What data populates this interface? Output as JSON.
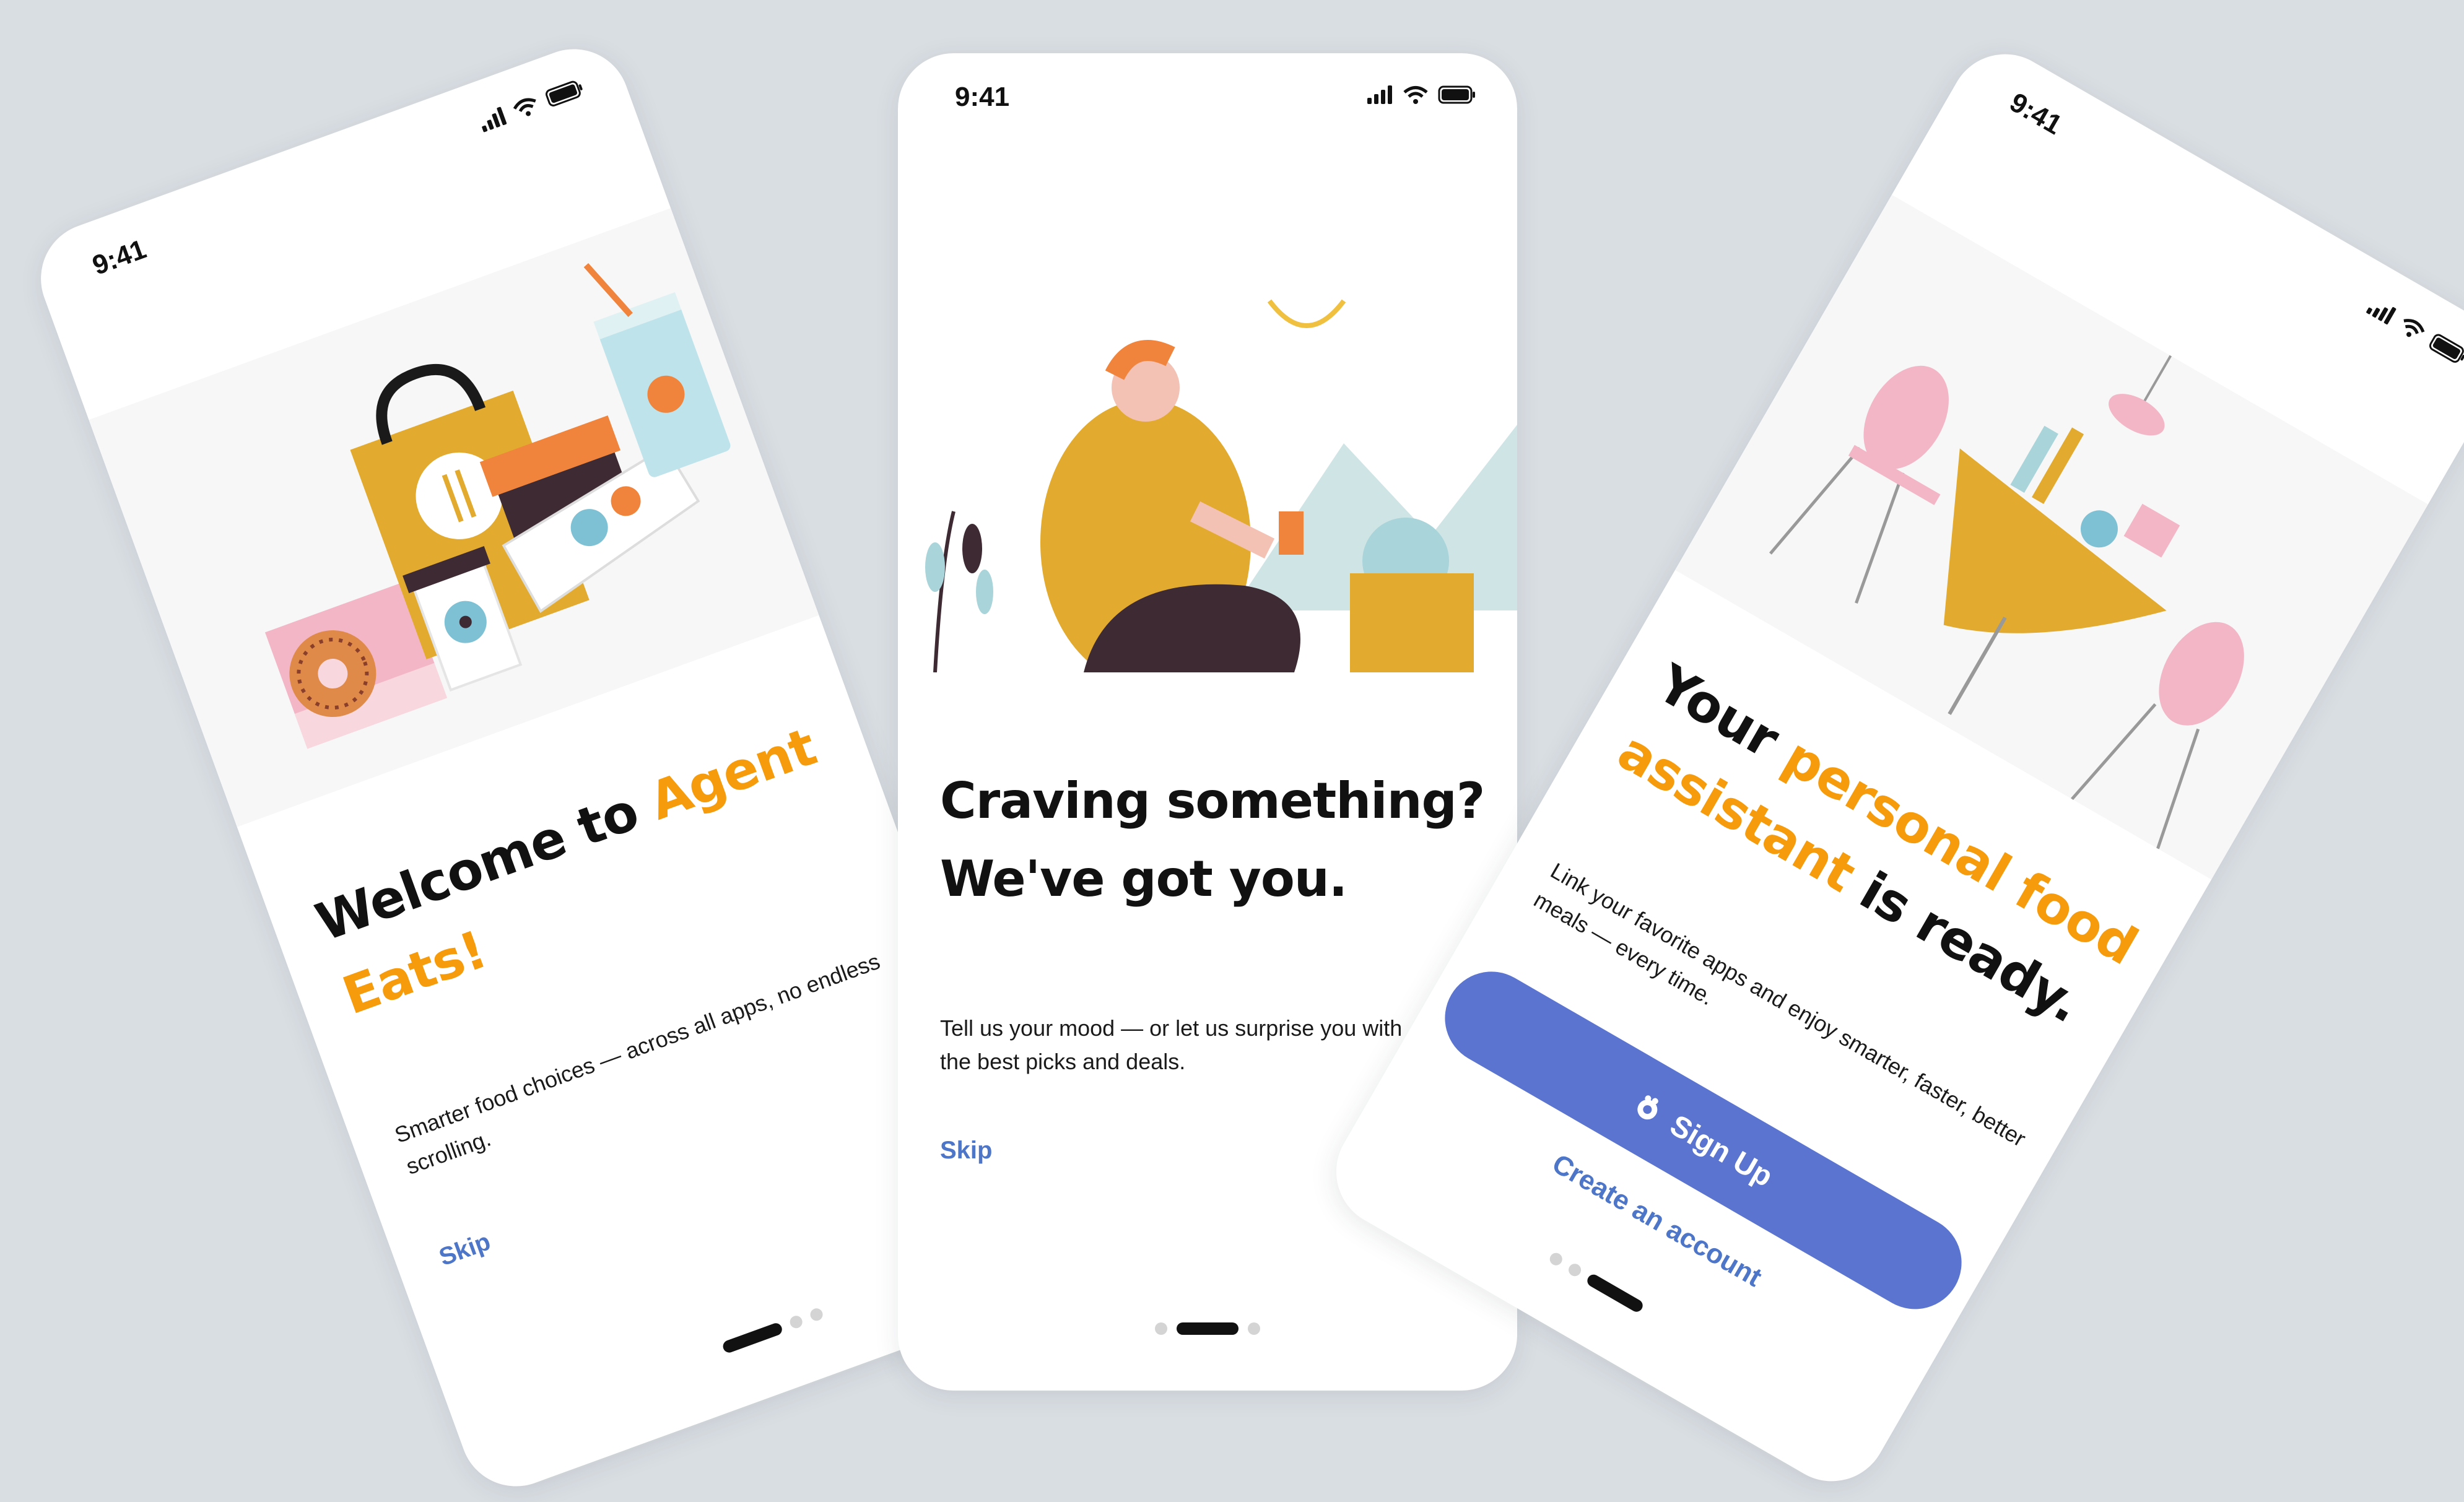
{
  "colors": {
    "accent": "#f59b0c",
    "link": "#4d75c8",
    "button": "#5a74d0",
    "background": "#d9dee3"
  },
  "screens": [
    {
      "time": "9:41",
      "title_pre": "Welcome to ",
      "title_accent": "Agent Eats!",
      "body": "Smarter food choices — across all apps, no endless scrolling.",
      "skip": "Skip",
      "active_page": 1
    },
    {
      "time": "9:41",
      "title": "Craving something? We've got you.",
      "body": "Tell us your mood — or let us surprise you with the best picks and deals.",
      "skip": "Skip",
      "active_page": 2
    },
    {
      "time": "9:41",
      "title_pre": "Your ",
      "title_accent": "personal food assistant",
      "title_post": " is ready.",
      "body": "Link your favorite apps and enjoy smarter, faster, better meals — every time.",
      "signup": "Sign Up",
      "create": "Create an account",
      "active_page": 3
    }
  ]
}
